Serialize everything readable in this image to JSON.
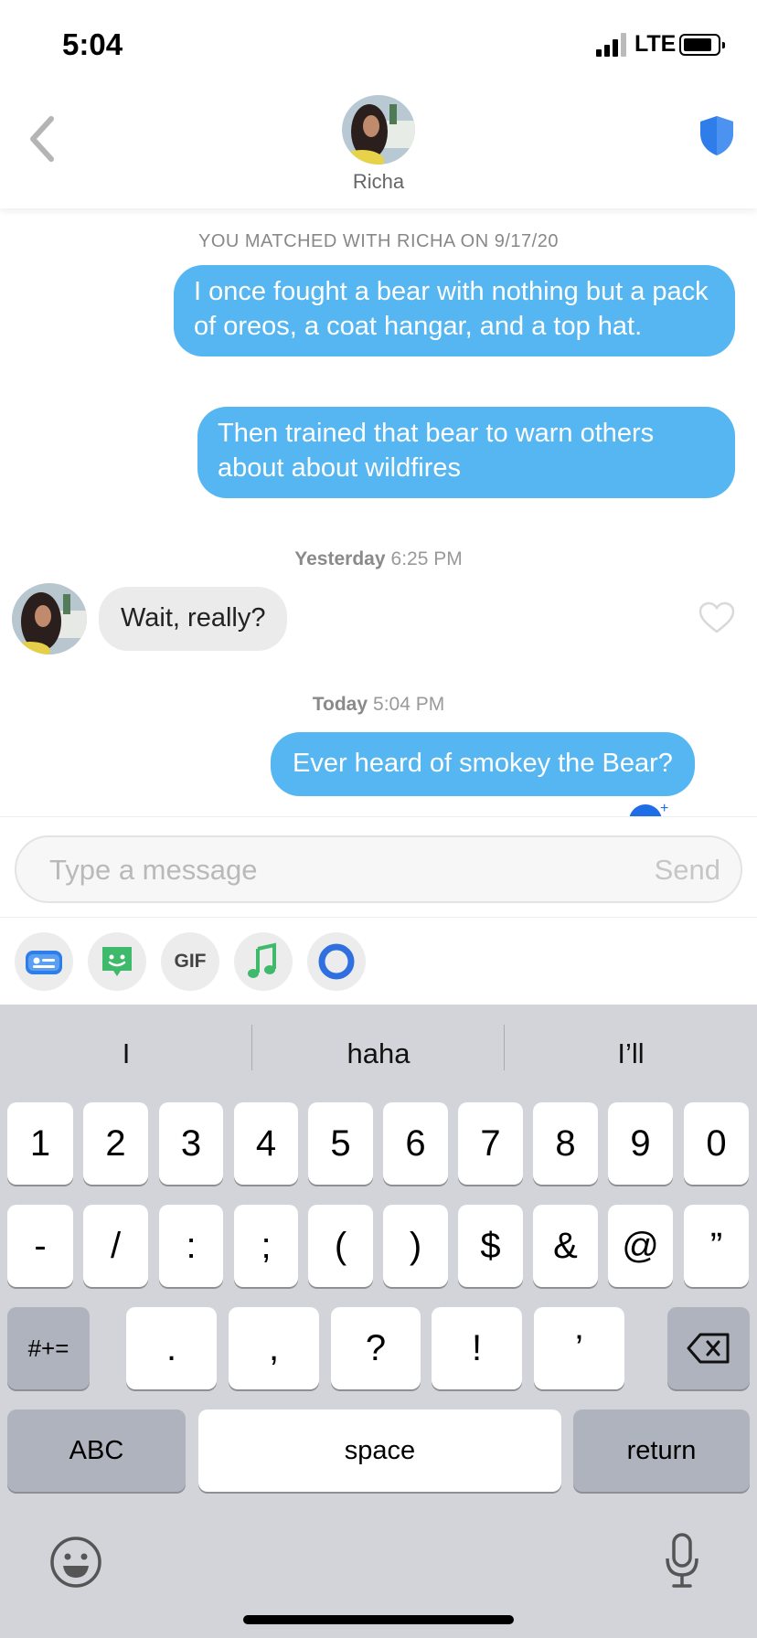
{
  "status_bar": {
    "time": "5:04",
    "network": "LTE"
  },
  "header": {
    "name": "Richa"
  },
  "chat": {
    "match_banner": "YOU MATCHED WITH RICHA ON 9/17/20",
    "messages": [
      {
        "from": "me",
        "text": "I once fought a bear with nothing but a pack of oreos, a coat hangar, and a top hat."
      },
      {
        "from": "me",
        "text": "Then trained that bear to warn others about about wildfires"
      },
      {
        "from": "them",
        "text": "Wait, really?"
      },
      {
        "from": "me",
        "text": "Ever heard of smokey the Bear?"
      }
    ],
    "separators": [
      {
        "day": "Yesterday",
        "time": "6:25 PM"
      },
      {
        "day": "Today",
        "time": "5:04 PM"
      }
    ]
  },
  "composer": {
    "placeholder": "Type a message",
    "send_label": "Send"
  },
  "tools": {
    "gif_label": "GIF"
  },
  "keyboard": {
    "suggestions": [
      "I",
      "haha",
      "I’ll"
    ],
    "row1": [
      "1",
      "2",
      "3",
      "4",
      "5",
      "6",
      "7",
      "8",
      "9",
      "0"
    ],
    "row2": [
      "-",
      "/",
      ":",
      ";",
      "(",
      ")",
      "$",
      "&",
      "@",
      "”"
    ],
    "row3": {
      "mode": "#+=",
      "keys": [
        ".",
        ",",
        "?",
        "!",
        "’"
      ]
    },
    "row4": {
      "abc": "ABC",
      "space": "space",
      "return": "return"
    }
  },
  "colors": {
    "my_bubble": "#55b6f2",
    "their_bubble": "#ebebeb",
    "accent": "#2f7de8"
  }
}
